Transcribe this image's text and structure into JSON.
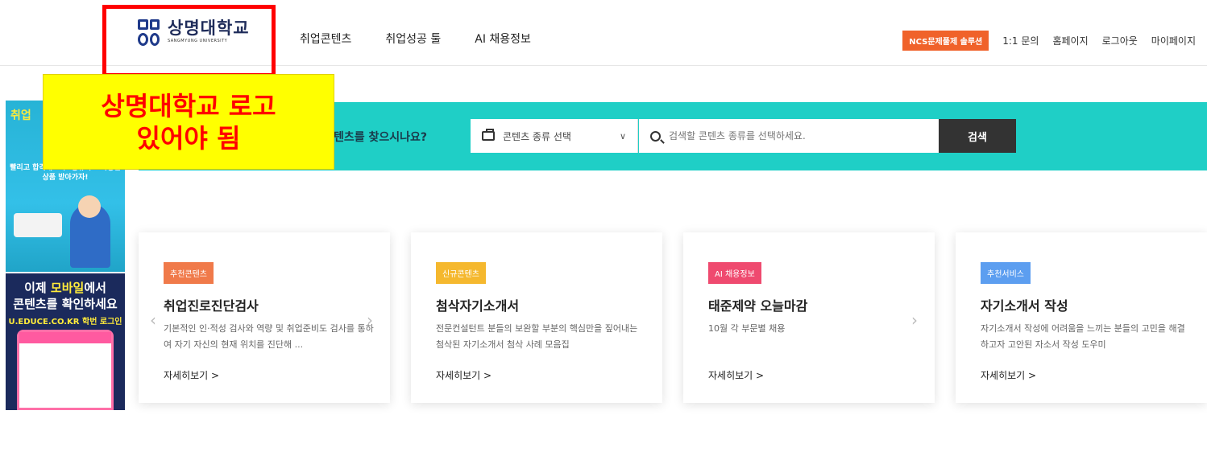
{
  "header": {
    "logo_kr": "상명대학교",
    "logo_en": "SANGMYUNG UNIVERSITY",
    "nav": [
      "취업콘텐츠",
      "취업성공 툴",
      "AI 채용정보"
    ],
    "ncs_button": "NCS문제풀제 솔루션",
    "util": [
      "1:1 문의",
      "홈페이지",
      "로그아웃",
      "마이페이지"
    ]
  },
  "annotation": {
    "line1": "상명대학교 로고",
    "line2": "있어야 됨"
  },
  "side_banner": {
    "top_title": "취업",
    "top_text": "빨리고 합격해보자! 공유하고 다양한상품 받아가자!",
    "bottom_line1_pre": "이제 ",
    "bottom_line1_em": "모바일",
    "bottom_line1_post": "에서",
    "bottom_line2": "콘텐츠를 확인하세요",
    "bottom_url": "U.EDUCE.CO.KR 학번 로그인"
  },
  "search": {
    "label": "텐츠를 찾으시나요?",
    "select_value": "콘텐츠 종류 선택",
    "input_placeholder": "검색할 콘텐츠 종류를 선택하세요.",
    "button": "검색"
  },
  "cards": [
    {
      "badge": "추천콘텐츠",
      "badge_color": "#f07a4a",
      "title": "취업진로진단검사",
      "desc": "기본적인 인·적성 검사와 역량 및 취업준비도 검사를 통하여 자기 자신의 현재 위치를 진단해 ...",
      "more": "자세히보기 >"
    },
    {
      "badge": "신규콘텐츠",
      "badge_color": "#f5b82e",
      "title": "첨삭자기소개서",
      "desc": "전문컨설턴트 분들의 보완할 부분의 핵심만을 짚어내는 첨삭된 자기소개서 첨삭 사례 모음집",
      "more": "자세히보기 >"
    },
    {
      "badge": "AI 채용정보",
      "badge_color": "#ef4a6f",
      "title": "태준제약 오늘마감",
      "desc": "10월 각 부문별 채용",
      "more": "자세히보기 >"
    },
    {
      "badge": "추천서비스",
      "badge_color": "#5c9ef0",
      "title": "자기소개서 작성",
      "desc": "자기소개서 작성에 어려움을 느끼는 분들의 고민을 해결하고자 고안된 자소서 작성 도우미",
      "more": "자세히보기 >"
    }
  ],
  "colors": {
    "accent_teal": "#1fcfc6",
    "annotation_yellow": "#ffff00",
    "annotation_red": "#ff0000"
  }
}
